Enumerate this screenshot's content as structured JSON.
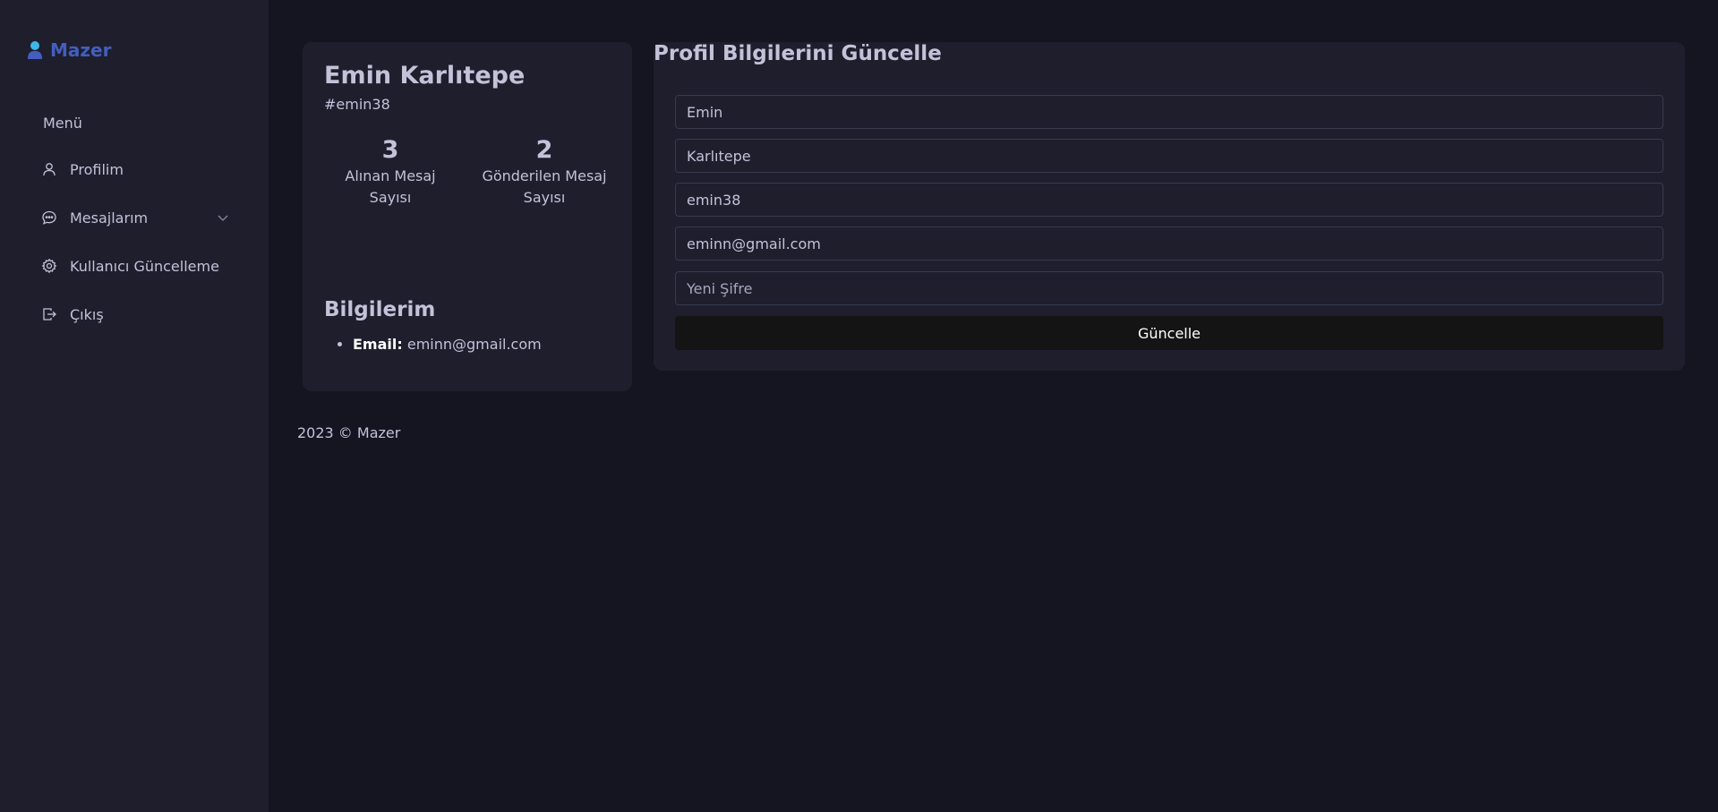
{
  "brand": {
    "name": "Mazer",
    "accent_color": "#435ebe",
    "icon": "user-icon"
  },
  "sidebar": {
    "menu_title": "Menü",
    "items": [
      {
        "label": "Profilim",
        "icon": "user-icon"
      },
      {
        "label": "Mesajlarım",
        "icon": "message-icon",
        "has_submenu": true
      },
      {
        "label": "Kullanıcı Güncelleme",
        "icon": "gear-icon"
      },
      {
        "label": "Çıkış",
        "icon": "logout-icon"
      }
    ]
  },
  "profile": {
    "name": "Emin Karlıtepe",
    "handle": "#emin38",
    "stats": [
      {
        "value": "3",
        "label_line1": "Alınan Mesaj",
        "label_line2": "Sayısı"
      },
      {
        "value": "2",
        "label_line1": "Gönderilen Mesaj",
        "label_line2": "Sayısı"
      }
    ],
    "info_title": "Bilgilerim",
    "info": {
      "email_label": "Email:",
      "email_value": "eminn@gmail.com"
    }
  },
  "form": {
    "title": "Profil Bilgilerini Güncelle",
    "first_name": "Emin",
    "last_name": "Karlıtepe",
    "username": "emin38",
    "email": "eminn@gmail.com",
    "password_placeholder": "Yeni Şifre",
    "submit_label": "Güncelle"
  },
  "footer": {
    "text": "2023 © Mazer"
  }
}
